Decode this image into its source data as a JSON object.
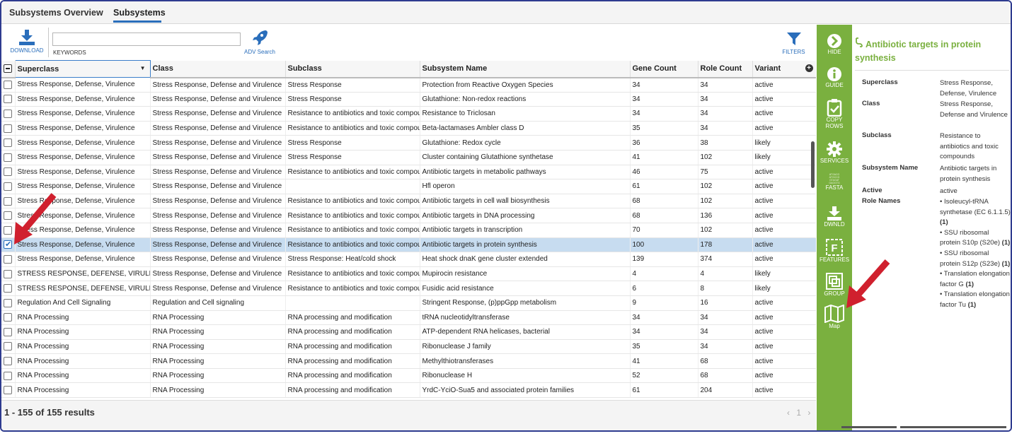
{
  "tabs": [
    {
      "label": "Subsystems Overview"
    },
    {
      "label": "Subsystems"
    }
  ],
  "toolbar": {
    "download_label": "DOWNLOAD",
    "keywords_label": "KEYWORDS",
    "keywords_value": "",
    "adv_search_label": "ADV Search",
    "filters_label": "FILTERS"
  },
  "columns": [
    "Superclass",
    "Class",
    "Subclass",
    "Subsystem Name",
    "Gene Count",
    "Role Count",
    "Variant"
  ],
  "rows": [
    {
      "checked": false,
      "superclass": "Stress Response, Defense, Virulence",
      "class": "Stress Response, Defense and Virulence",
      "subclass": "Stress Response",
      "name": "Protection from Reactive Oxygen Species",
      "gene_count": "34",
      "role_count": "34",
      "variant": "active"
    },
    {
      "checked": false,
      "superclass": "Stress Response, Defense, Virulence",
      "class": "Stress Response, Defense and Virulence",
      "subclass": "Stress Response",
      "name": "Glutathione: Non-redox reactions",
      "gene_count": "34",
      "role_count": "34",
      "variant": "active"
    },
    {
      "checked": false,
      "superclass": "Stress Response, Defense, Virulence",
      "class": "Stress Response, Defense and Virulence",
      "subclass": "Resistance to antibiotics and toxic compoun",
      "name": "Resistance to Triclosan",
      "gene_count": "34",
      "role_count": "34",
      "variant": "active"
    },
    {
      "checked": false,
      "superclass": "Stress Response, Defense, Virulence",
      "class": "Stress Response, Defense and Virulence",
      "subclass": "Resistance to antibiotics and toxic compoun",
      "name": "Beta-lactamases Ambler class D",
      "gene_count": "35",
      "role_count": "34",
      "variant": "active"
    },
    {
      "checked": false,
      "superclass": "Stress Response, Defense, Virulence",
      "class": "Stress Response, Defense and Virulence",
      "subclass": "Stress Response",
      "name": "Glutathione: Redox cycle",
      "gene_count": "36",
      "role_count": "38",
      "variant": "likely"
    },
    {
      "checked": false,
      "superclass": "Stress Response, Defense, Virulence",
      "class": "Stress Response, Defense and Virulence",
      "subclass": "Stress Response",
      "name": "Cluster containing Glutathione synthetase",
      "gene_count": "41",
      "role_count": "102",
      "variant": "likely"
    },
    {
      "checked": false,
      "superclass": "Stress Response, Defense, Virulence",
      "class": "Stress Response, Defense and Virulence",
      "subclass": "Resistance to antibiotics and toxic compoun",
      "name": "Antibiotic targets in metabolic pathways",
      "gene_count": "46",
      "role_count": "75",
      "variant": "active"
    },
    {
      "checked": false,
      "superclass": "Stress Response, Defense, Virulence",
      "class": "Stress Response, Defense and Virulence",
      "subclass": "",
      "name": "Hfl operon",
      "gene_count": "61",
      "role_count": "102",
      "variant": "active"
    },
    {
      "checked": false,
      "superclass": "Stress Response, Defense, Virulence",
      "class": "Stress Response, Defense and Virulence",
      "subclass": "Resistance to antibiotics and toxic compoun",
      "name": "Antibiotic targets in cell wall biosynthesis",
      "gene_count": "68",
      "role_count": "102",
      "variant": "active"
    },
    {
      "checked": false,
      "superclass": "Stress Response, Defense, Virulence",
      "class": "Stress Response, Defense and Virulence",
      "subclass": "Resistance to antibiotics and toxic compoun",
      "name": "Antibiotic targets in DNA processing",
      "gene_count": "68",
      "role_count": "136",
      "variant": "active"
    },
    {
      "checked": false,
      "superclass": "Stress Response, Defense, Virulence",
      "class": "Stress Response, Defense and Virulence",
      "subclass": "Resistance to antibiotics and toxic compoun",
      "name": "Antibiotic targets in transcription",
      "gene_count": "70",
      "role_count": "102",
      "variant": "active"
    },
    {
      "checked": true,
      "superclass": "Stress Response, Defense, Virulence",
      "class": "Stress Response, Defense and Virulence",
      "subclass": "Resistance to antibiotics and toxic compoun",
      "name": "Antibiotic targets in protein synthesis",
      "gene_count": "100",
      "role_count": "178",
      "variant": "active"
    },
    {
      "checked": false,
      "superclass": "Stress Response, Defense, Virulence",
      "class": "Stress Response, Defense and Virulence",
      "subclass": "Stress Response: Heat/cold shock",
      "name": "Heat shock dnaK gene cluster extended",
      "gene_count": "139",
      "role_count": "374",
      "variant": "active"
    },
    {
      "checked": false,
      "superclass": "STRESS RESPONSE, DEFENSE, VIRULEI",
      "class": "Stress Response, Defense and Virulence",
      "subclass": "Resistance to antibiotics and toxic compoun",
      "name": "Mupirocin resistance",
      "gene_count": "4",
      "role_count": "4",
      "variant": "likely"
    },
    {
      "checked": false,
      "superclass": "STRESS RESPONSE, DEFENSE, VIRULEI",
      "class": "Stress Response, Defense and Virulence",
      "subclass": "Resistance to antibiotics and toxic compoun",
      "name": "Fusidic acid resistance",
      "gene_count": "6",
      "role_count": "8",
      "variant": "likely"
    },
    {
      "checked": false,
      "superclass": "Regulation And Cell Signaling",
      "class": "Regulation and Cell signaling",
      "subclass": "",
      "name": "Stringent Response, (p)ppGpp metabolism",
      "gene_count": "9",
      "role_count": "16",
      "variant": "active"
    },
    {
      "checked": false,
      "superclass": "RNA Processing",
      "class": "RNA Processing",
      "subclass": "RNA processing and modification",
      "name": "tRNA nucleotidyltransferase",
      "gene_count": "34",
      "role_count": "34",
      "variant": "active"
    },
    {
      "checked": false,
      "superclass": "RNA Processing",
      "class": "RNA Processing",
      "subclass": "RNA processing and modification",
      "name": "ATP-dependent RNA helicases, bacterial",
      "gene_count": "34",
      "role_count": "34",
      "variant": "active"
    },
    {
      "checked": false,
      "superclass": "RNA Processing",
      "class": "RNA Processing",
      "subclass": "RNA processing and modification",
      "name": "Ribonuclease J family",
      "gene_count": "35",
      "role_count": "34",
      "variant": "active"
    },
    {
      "checked": false,
      "superclass": "RNA Processing",
      "class": "RNA Processing",
      "subclass": "RNA processing and modification",
      "name": "Methylthiotransferases",
      "gene_count": "41",
      "role_count": "68",
      "variant": "active"
    },
    {
      "checked": false,
      "superclass": "RNA Processing",
      "class": "RNA Processing",
      "subclass": "RNA processing and modification",
      "name": "Ribonuclease H",
      "gene_count": "52",
      "role_count": "68",
      "variant": "active"
    },
    {
      "checked": false,
      "superclass": "RNA Processing",
      "class": "RNA Processing",
      "subclass": "RNA processing and modification",
      "name": "YrdC-YciO-Sua5 and associated protein families",
      "gene_count": "61",
      "role_count": "204",
      "variant": "active"
    }
  ],
  "footer": {
    "results": "1 - 155 of 155 results",
    "page": "1",
    "prev": "‹",
    "next": "›"
  },
  "actions": {
    "hide": "HIDE",
    "guide": "GUIDE",
    "copy_rows_1": "COPY",
    "copy_rows_2": "ROWS",
    "services": "SERVICES",
    "fasta": "FASTA",
    "dwnld": "DWNLD",
    "features": "FEATURES",
    "group": "GROUP",
    "map": "Map"
  },
  "details": {
    "title": "Antibiotic targets in protein synthesis",
    "fields": [
      {
        "key": "Superclass",
        "value": "Stress Response, Defense, Virulence"
      },
      {
        "key": "Class",
        "value": "Stress Response, Defense and Virulence"
      },
      {
        "key": "Subclass",
        "value": "Resistance to antibiotics and toxic compounds"
      },
      {
        "key": "Subsystem Name",
        "value": "Antibiotic targets in protein synthesis"
      },
      {
        "key": "Active",
        "value": "active"
      }
    ],
    "role_names_label": "Role Names",
    "role_names": [
      {
        "name": "Isoleucyl-tRNA synthetase (EC 6.1.1.5)",
        "count": "(1)"
      },
      {
        "name": "SSU ribosomal protein S10p (S20e)",
        "count": "(1)"
      },
      {
        "name": "SSU ribosomal protein S12p (S23e)",
        "count": "(1)"
      },
      {
        "name": "Translation elongation factor G",
        "count": "(1)"
      },
      {
        "name": "Translation elongation factor Tu",
        "count": "(1)"
      }
    ]
  },
  "colors": {
    "accent_green": "#7ab03f",
    "link_blue": "#2a6ebb",
    "selected_row": "#c7dcf0",
    "arrow_red": "#d0202e"
  }
}
